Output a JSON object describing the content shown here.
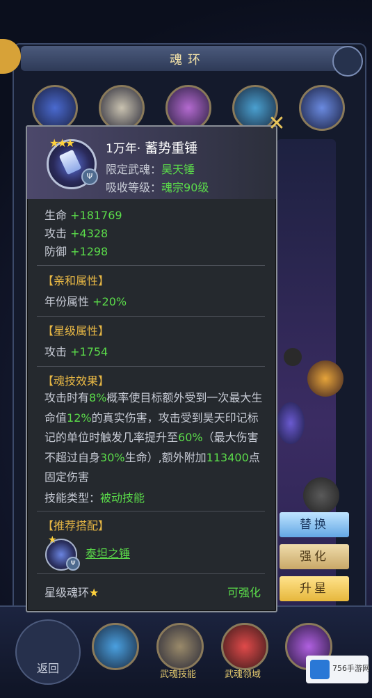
{
  "background": {
    "window_title": "魂环",
    "back_label": "返回",
    "slot_labels": [
      "",
      "武魂技能",
      "武魂领域",
      ""
    ],
    "watermark": "756手游网"
  },
  "panel": {
    "title_age": "1万年·",
    "title_name": "蓄势重锤",
    "limit_label": "限定武魂：",
    "limit_value": "昊天锤",
    "absorb_label": "吸收等级：",
    "absorb_value": "魂宗90级",
    "stats": [
      {
        "label": "生命",
        "value": "+181769"
      },
      {
        "label": "攻击",
        "value": "+4328"
      },
      {
        "label": "防御",
        "value": "+1298"
      }
    ],
    "affinity": {
      "header": "【亲和属性】",
      "label": "年份属性",
      "value": "+20%"
    },
    "star_attr": {
      "header": "【星级属性】",
      "label": "攻击",
      "value": "+1754"
    },
    "skill": {
      "header": "【魂技效果】",
      "p1": "攻击时有",
      "v1": "8%",
      "p2": "概率使目标额外受到一次最大生命值",
      "v2": "12%",
      "p3": "的真实伤害，攻击受到昊天印记标记的单位时触发几率提升至",
      "v3": "60%",
      "p4": "（最大伤害不超过自身",
      "v4": "30%",
      "p5": "生命）,额外附加",
      "v5": "113400",
      "p6": "点固定伤害",
      "type_label": "技能类型：",
      "type_value": "被动技能"
    },
    "recommend": {
      "header": "【推荐搭配】",
      "item": "泰坦之锤"
    },
    "footer_left": "星级魂环",
    "footer_right": "可强化"
  },
  "buttons": {
    "replace": "替换",
    "enhance": "强化",
    "upstar": "升星"
  }
}
